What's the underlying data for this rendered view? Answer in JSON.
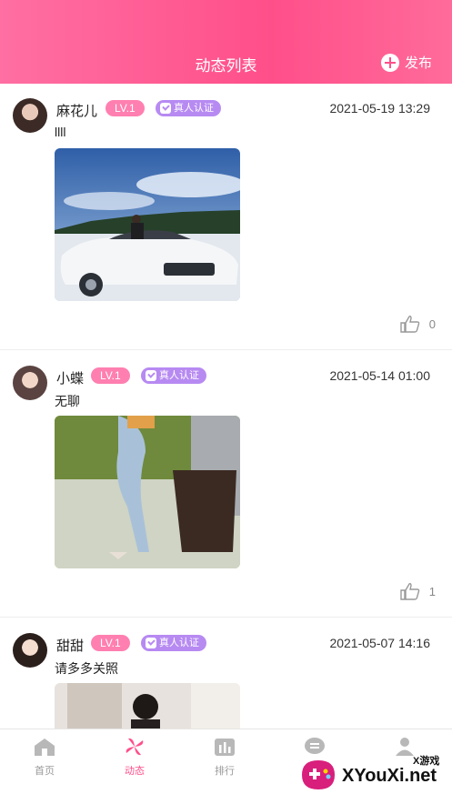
{
  "header": {
    "title": "动态列表",
    "publish_label": "发布"
  },
  "posts": [
    {
      "user": "麻花儿",
      "level": "LV.1",
      "verify": "真人认证",
      "time": "2021-05-19 13:29",
      "text": "llll",
      "likes": "0"
    },
    {
      "user": "小蝶",
      "level": "LV.1",
      "verify": "真人认证",
      "time": "2021-05-14 01:00",
      "text": "无聊",
      "likes": "1"
    },
    {
      "user": "甜甜",
      "level": "LV.1",
      "verify": "真人认证",
      "time": "2021-05-07 14:16",
      "text": "请多多关照"
    }
  ],
  "tabs": [
    {
      "label": "首页",
      "icon": "home-icon"
    },
    {
      "label": "动态",
      "icon": "pinwheel-icon"
    },
    {
      "label": "排行",
      "icon": "ranking-icon"
    },
    {
      "label": "消息",
      "icon": "message-icon"
    },
    {
      "label": "我的",
      "icon": "profile-icon"
    }
  ],
  "watermark": {
    "small": "X游戏",
    "big": "XYouXi.net"
  },
  "colors": {
    "accent": "#ff4f8a",
    "level_badge": "#ff7fb0",
    "verify_badge": "#b78af2"
  }
}
